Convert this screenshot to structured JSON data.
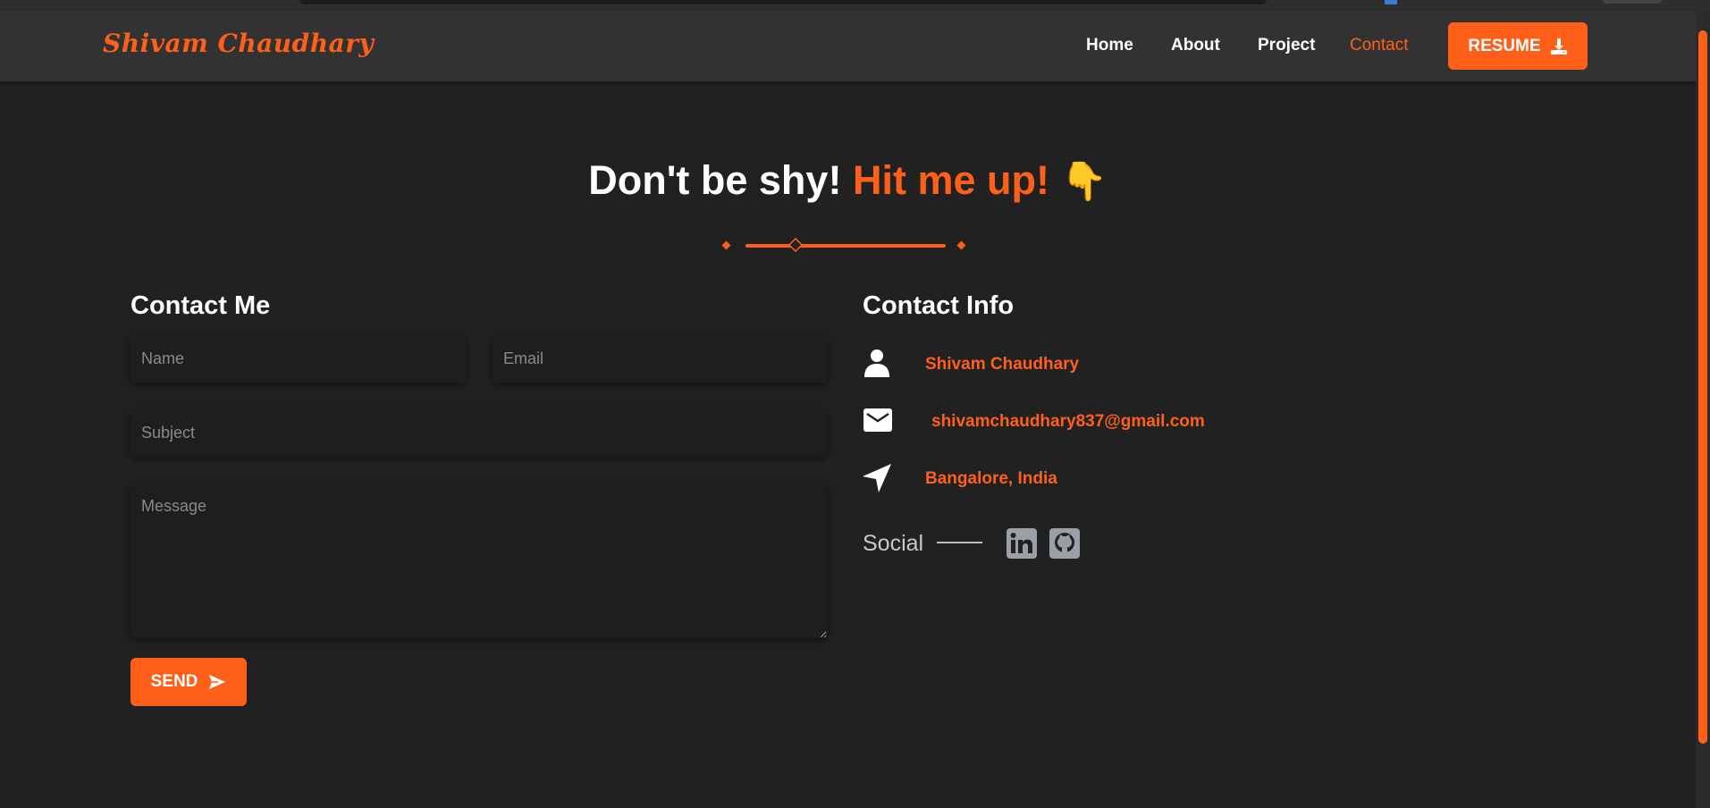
{
  "brand": "Shivam Chaudhary",
  "nav": {
    "links": [
      "Home",
      "About",
      "Project",
      "Contact"
    ],
    "active": "Contact",
    "resume_label": "RESUME"
  },
  "headline": {
    "part1": "Don't be shy!",
    "part2": "Hit me up!",
    "emoji": "👇"
  },
  "contact_form": {
    "title": "Contact Me",
    "name_placeholder": "Name",
    "email_placeholder": "Email",
    "subject_placeholder": "Subject",
    "message_placeholder": "Message",
    "send_label": "SEND"
  },
  "contact_info": {
    "title": "Contact Info",
    "name": "Shivam Chaudhary",
    "email": "shivamchaudhary837@gmail.com",
    "location": "Bangalore, India",
    "social_label": "Social",
    "social_icons": [
      "linkedin-icon",
      "github-icon"
    ]
  },
  "colors": {
    "accent": "#ff6019",
    "background": "#212121",
    "navbar": "#323232"
  }
}
